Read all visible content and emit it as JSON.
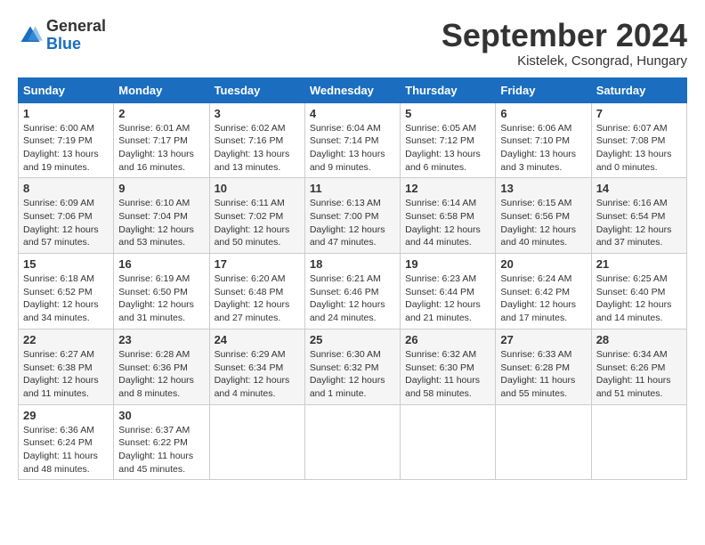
{
  "header": {
    "logo_general": "General",
    "logo_blue": "Blue",
    "title": "September 2024",
    "location": "Kistelek, Csongrad, Hungary"
  },
  "days_of_week": [
    "Sunday",
    "Monday",
    "Tuesday",
    "Wednesday",
    "Thursday",
    "Friday",
    "Saturday"
  ],
  "weeks": [
    [
      {
        "day": "1",
        "sunrise": "6:00 AM",
        "sunset": "7:19 PM",
        "daylight": "13 hours and 19 minutes."
      },
      {
        "day": "2",
        "sunrise": "6:01 AM",
        "sunset": "7:17 PM",
        "daylight": "13 hours and 16 minutes."
      },
      {
        "day": "3",
        "sunrise": "6:02 AM",
        "sunset": "7:16 PM",
        "daylight": "13 hours and 13 minutes."
      },
      {
        "day": "4",
        "sunrise": "6:04 AM",
        "sunset": "7:14 PM",
        "daylight": "13 hours and 9 minutes."
      },
      {
        "day": "5",
        "sunrise": "6:05 AM",
        "sunset": "7:12 PM",
        "daylight": "13 hours and 6 minutes."
      },
      {
        "day": "6",
        "sunrise": "6:06 AM",
        "sunset": "7:10 PM",
        "daylight": "13 hours and 3 minutes."
      },
      {
        "day": "7",
        "sunrise": "6:07 AM",
        "sunset": "7:08 PM",
        "daylight": "13 hours and 0 minutes."
      }
    ],
    [
      {
        "day": "8",
        "sunrise": "6:09 AM",
        "sunset": "7:06 PM",
        "daylight": "12 hours and 57 minutes."
      },
      {
        "day": "9",
        "sunrise": "6:10 AM",
        "sunset": "7:04 PM",
        "daylight": "12 hours and 53 minutes."
      },
      {
        "day": "10",
        "sunrise": "6:11 AM",
        "sunset": "7:02 PM",
        "daylight": "12 hours and 50 minutes."
      },
      {
        "day": "11",
        "sunrise": "6:13 AM",
        "sunset": "7:00 PM",
        "daylight": "12 hours and 47 minutes."
      },
      {
        "day": "12",
        "sunrise": "6:14 AM",
        "sunset": "6:58 PM",
        "daylight": "12 hours and 44 minutes."
      },
      {
        "day": "13",
        "sunrise": "6:15 AM",
        "sunset": "6:56 PM",
        "daylight": "12 hours and 40 minutes."
      },
      {
        "day": "14",
        "sunrise": "6:16 AM",
        "sunset": "6:54 PM",
        "daylight": "12 hours and 37 minutes."
      }
    ],
    [
      {
        "day": "15",
        "sunrise": "6:18 AM",
        "sunset": "6:52 PM",
        "daylight": "12 hours and 34 minutes."
      },
      {
        "day": "16",
        "sunrise": "6:19 AM",
        "sunset": "6:50 PM",
        "daylight": "12 hours and 31 minutes."
      },
      {
        "day": "17",
        "sunrise": "6:20 AM",
        "sunset": "6:48 PM",
        "daylight": "12 hours and 27 minutes."
      },
      {
        "day": "18",
        "sunrise": "6:21 AM",
        "sunset": "6:46 PM",
        "daylight": "12 hours and 24 minutes."
      },
      {
        "day": "19",
        "sunrise": "6:23 AM",
        "sunset": "6:44 PM",
        "daylight": "12 hours and 21 minutes."
      },
      {
        "day": "20",
        "sunrise": "6:24 AM",
        "sunset": "6:42 PM",
        "daylight": "12 hours and 17 minutes."
      },
      {
        "day": "21",
        "sunrise": "6:25 AM",
        "sunset": "6:40 PM",
        "daylight": "12 hours and 14 minutes."
      }
    ],
    [
      {
        "day": "22",
        "sunrise": "6:27 AM",
        "sunset": "6:38 PM",
        "daylight": "12 hours and 11 minutes."
      },
      {
        "day": "23",
        "sunrise": "6:28 AM",
        "sunset": "6:36 PM",
        "daylight": "12 hours and 8 minutes."
      },
      {
        "day": "24",
        "sunrise": "6:29 AM",
        "sunset": "6:34 PM",
        "daylight": "12 hours and 4 minutes."
      },
      {
        "day": "25",
        "sunrise": "6:30 AM",
        "sunset": "6:32 PM",
        "daylight": "12 hours and 1 minute."
      },
      {
        "day": "26",
        "sunrise": "6:32 AM",
        "sunset": "6:30 PM",
        "daylight": "11 hours and 58 minutes."
      },
      {
        "day": "27",
        "sunrise": "6:33 AM",
        "sunset": "6:28 PM",
        "daylight": "11 hours and 55 minutes."
      },
      {
        "day": "28",
        "sunrise": "6:34 AM",
        "sunset": "6:26 PM",
        "daylight": "11 hours and 51 minutes."
      }
    ],
    [
      {
        "day": "29",
        "sunrise": "6:36 AM",
        "sunset": "6:24 PM",
        "daylight": "11 hours and 48 minutes."
      },
      {
        "day": "30",
        "sunrise": "6:37 AM",
        "sunset": "6:22 PM",
        "daylight": "11 hours and 45 minutes."
      },
      null,
      null,
      null,
      null,
      null
    ]
  ]
}
